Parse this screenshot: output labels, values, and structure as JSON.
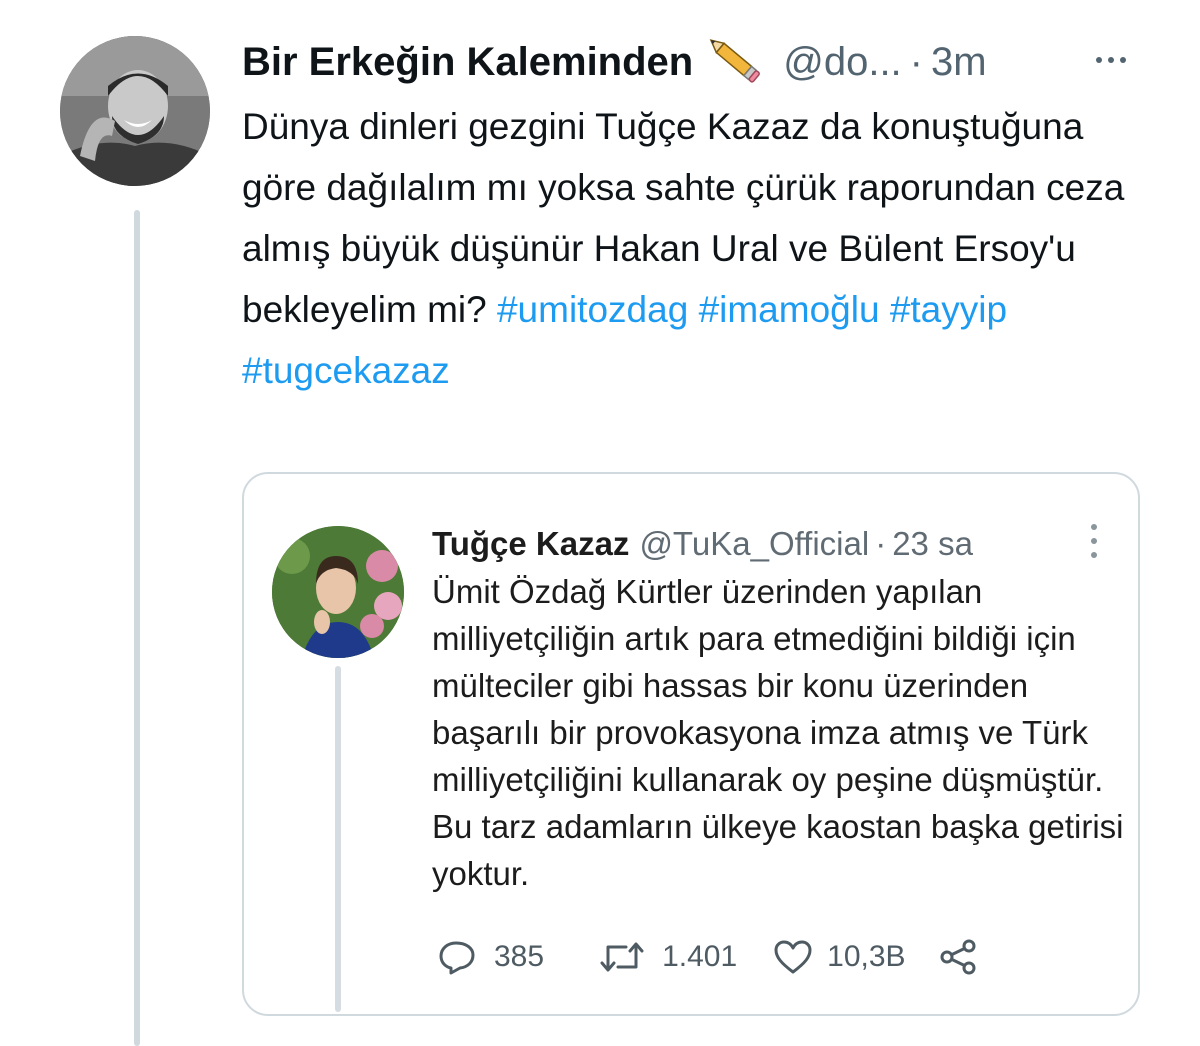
{
  "tweet": {
    "author": {
      "display_name": "Bir Erkeğin Kaleminden",
      "emoji_icon": "pencil-icon",
      "handle": "@do...",
      "separator": "·",
      "time": "3m"
    },
    "text_plain": "Dünya dinleri gezgini Tuğçe Kazaz da konuştuğuna göre dağılalım mı yoksa sahte çürük raporundan ceza almış büyük düşünür Hakan Ural ve Bülent Ersoy'u bekleyelim mi?",
    "hashtags": [
      "#umitozdag",
      "#imamoğlu",
      "#tayyip",
      "#tugcekazaz"
    ]
  },
  "quoted_tweet": {
    "author": {
      "display_name": "Tuğçe Kazaz",
      "handle": "@TuKa_Official",
      "separator": "·",
      "time": "23 sa"
    },
    "text": "Ümit Özdağ Kürtler üzerinden yapılan milliyetçiliğin artık para etmediğini bildiği için mülteciler gibi hassas bir konu üzerinden başarılı bir provokasyona imza atmış ve Türk milliyetçiliğini kullanarak oy peşine düşmüştür. Bu tarz adamların ülkeye kaostan başka getirisi yoktur.",
    "actions": {
      "replies": "385",
      "retweets": "1.401",
      "likes": "10,3B"
    }
  },
  "colors": {
    "accent": "#1d9bf0",
    "text": "#0f1419",
    "muted": "#536471",
    "border": "#cfd9de"
  }
}
